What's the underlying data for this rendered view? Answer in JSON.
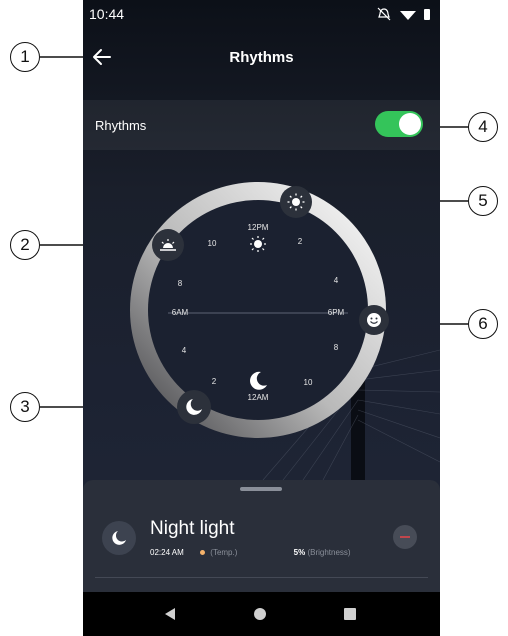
{
  "status_bar": {
    "time": "10:44",
    "icons": [
      "mute-icon",
      "wifi-icon",
      "battery-icon"
    ]
  },
  "header": {
    "title": "Rhythms",
    "back_icon": "arrow-left-icon"
  },
  "rhythms_row": {
    "label": "Rhythms",
    "toggle_on": true,
    "accent": "#34c45a"
  },
  "dial": {
    "labels": [
      "12PM",
      "2",
      "4",
      "6PM",
      "8",
      "10",
      "12AM",
      "2",
      "4",
      "6AM",
      "8",
      "10"
    ],
    "markers": [
      {
        "name": "sunrise-icon"
      },
      {
        "name": "sun-icon"
      },
      {
        "name": "smiley-icon"
      },
      {
        "name": "moon-icon"
      }
    ]
  },
  "bottom_sheet": {
    "item_title": "Night light",
    "item_time": "02:24 AM",
    "temp_text": "(Temp.)",
    "brightness_value": "5%",
    "brightness_text": "(Brightness)",
    "remove_icon": "minus-circle-icon"
  },
  "callouts": [
    "1",
    "2",
    "3",
    "4",
    "5",
    "6"
  ],
  "nav": {
    "back": "back-triangle-icon",
    "home": "home-circle-icon",
    "recents": "recents-square-icon"
  }
}
